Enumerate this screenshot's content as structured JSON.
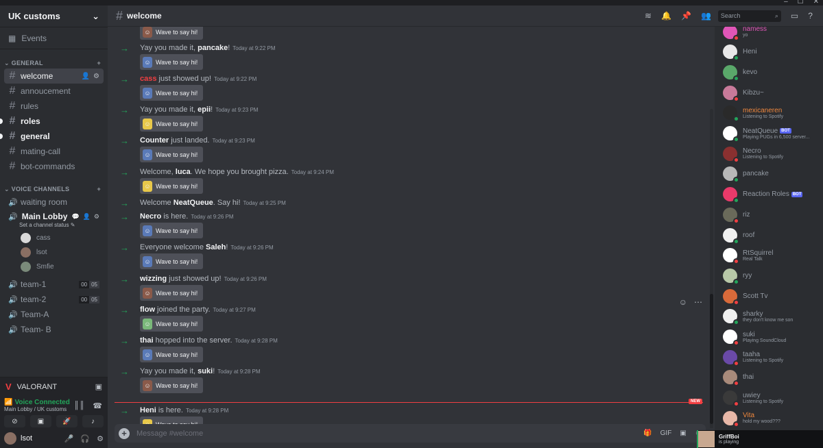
{
  "window": {
    "controls": [
      "–",
      "☐",
      "✕"
    ]
  },
  "server": {
    "name": "UK customs",
    "events_label": "Events"
  },
  "categories": {
    "general": "GENERAL",
    "voice": "VOICE CHANNELS"
  },
  "text_channels": [
    {
      "name": "welcome"
    },
    {
      "name": "annoucement"
    },
    {
      "name": "rules"
    },
    {
      "name": "roles"
    },
    {
      "name": "general"
    },
    {
      "name": "mating-call"
    },
    {
      "name": "bot-commands"
    }
  ],
  "voice_channels": {
    "waiting": "waiting room",
    "lobby": {
      "name": "Main Lobby",
      "status": "Set a channel status",
      "users": [
        "cass",
        "lsot",
        "Smfie"
      ]
    },
    "others": [
      {
        "name": "team-1",
        "count_a": "00",
        "count_b": "05"
      },
      {
        "name": "team-2",
        "count_a": "00",
        "count_b": "05"
      },
      {
        "name": "Team-A"
      },
      {
        "name": "Team- B"
      }
    ]
  },
  "activity": {
    "game": "VALORANT"
  },
  "voice_status": {
    "state": "Voice Connected",
    "location": "Main Lobby / UK customs"
  },
  "user": {
    "name": "lsot"
  },
  "channel": {
    "name": "welcome",
    "placeholder": "Message #welcome"
  },
  "wave_label": "Wave to say hi!",
  "messages": [
    {
      "pre": "Yay you made it, ",
      "user": "pancake",
      "post": "!",
      "time": "Today at 9:22 PM"
    },
    {
      "pre": "",
      "user": "cass",
      "post": " just showed up!",
      "time": "Today at 9:22 PM"
    },
    {
      "pre": "Yay you made it, ",
      "user": "epii",
      "post": "!",
      "time": "Today at 9:23 PM"
    },
    {
      "pre": "",
      "user": "Counter",
      "post": " just landed.",
      "time": "Today at 9:23 PM"
    },
    {
      "pre": "Welcome, ",
      "user": "luca",
      "post": ". We hope you brought pizza.",
      "time": "Today at 9:24 PM"
    },
    {
      "pre": "Welcome ",
      "user": "NeatQueue",
      "post": ". Say hi!",
      "time": "Today at 9:25 PM"
    },
    {
      "pre": "",
      "user": "Necro",
      "post": " is here.",
      "time": "Today at 9:26 PM"
    },
    {
      "pre": "Everyone welcome ",
      "user": "Saleh",
      "post": "!",
      "time": "Today at 9:26 PM"
    },
    {
      "pre": "",
      "user": "wizzing",
      "post": " just showed up!",
      "time": "Today at 9:26 PM"
    },
    {
      "pre": "",
      "user": "flow",
      "post": " joined the party.",
      "time": "Today at 9:27 PM"
    },
    {
      "pre": "",
      "user": "thai",
      "post": " hopped into the server.",
      "time": "Today at 9:28 PM"
    },
    {
      "pre": "Yay you made it, ",
      "user": "suki",
      "post": "!",
      "time": "Today at 9:28 PM"
    },
    {
      "pre": "",
      "user": "Heni",
      "post": " is here.",
      "time": "Today at 9:28 PM"
    }
  ],
  "new_label": "NEW",
  "search_placeholder": "Search",
  "bot_label": "BOT",
  "members": [
    {
      "name": "namess",
      "activity": "yo",
      "color": "#e056b8"
    },
    {
      "name": "Heni",
      "activity": ""
    },
    {
      "name": "kevo",
      "activity": ""
    },
    {
      "name": "Kibzu~",
      "activity": ""
    },
    {
      "name": "mexicaneren",
      "activity": "Listening to Spotify",
      "color": "#f0883e"
    },
    {
      "name": "NeatQueue",
      "activity": "Playing PUGs in 6,500 server...",
      "bot": true
    },
    {
      "name": "Necro",
      "activity": "Listening to Spotify"
    },
    {
      "name": "pancake",
      "activity": ""
    },
    {
      "name": "Reaction Roles",
      "activity": "",
      "bot": true
    },
    {
      "name": "riz",
      "activity": ""
    },
    {
      "name": "roof",
      "activity": ""
    },
    {
      "name": "RtSquirrel",
      "activity": "Real Talk"
    },
    {
      "name": "ryy",
      "activity": ""
    },
    {
      "name": "Scott Tv",
      "activity": ""
    },
    {
      "name": "sharky",
      "activity": "they don't know me son"
    },
    {
      "name": "suki",
      "activity": "Playing SoundCloud"
    },
    {
      "name": "taaha",
      "activity": "Listening to Spotify"
    },
    {
      "name": "thai",
      "activity": ""
    },
    {
      "name": "uwiey",
      "activity": "Listening to Spotify"
    },
    {
      "name": "Vita",
      "activity": "hold my wood???",
      "color": "#f0883e"
    }
  ],
  "toast": {
    "name": "GriffBoi",
    "text": "is playing"
  },
  "colors": {
    "online": "#23a55a",
    "dnd": "#f23f42",
    "accent": "#5865f2"
  }
}
